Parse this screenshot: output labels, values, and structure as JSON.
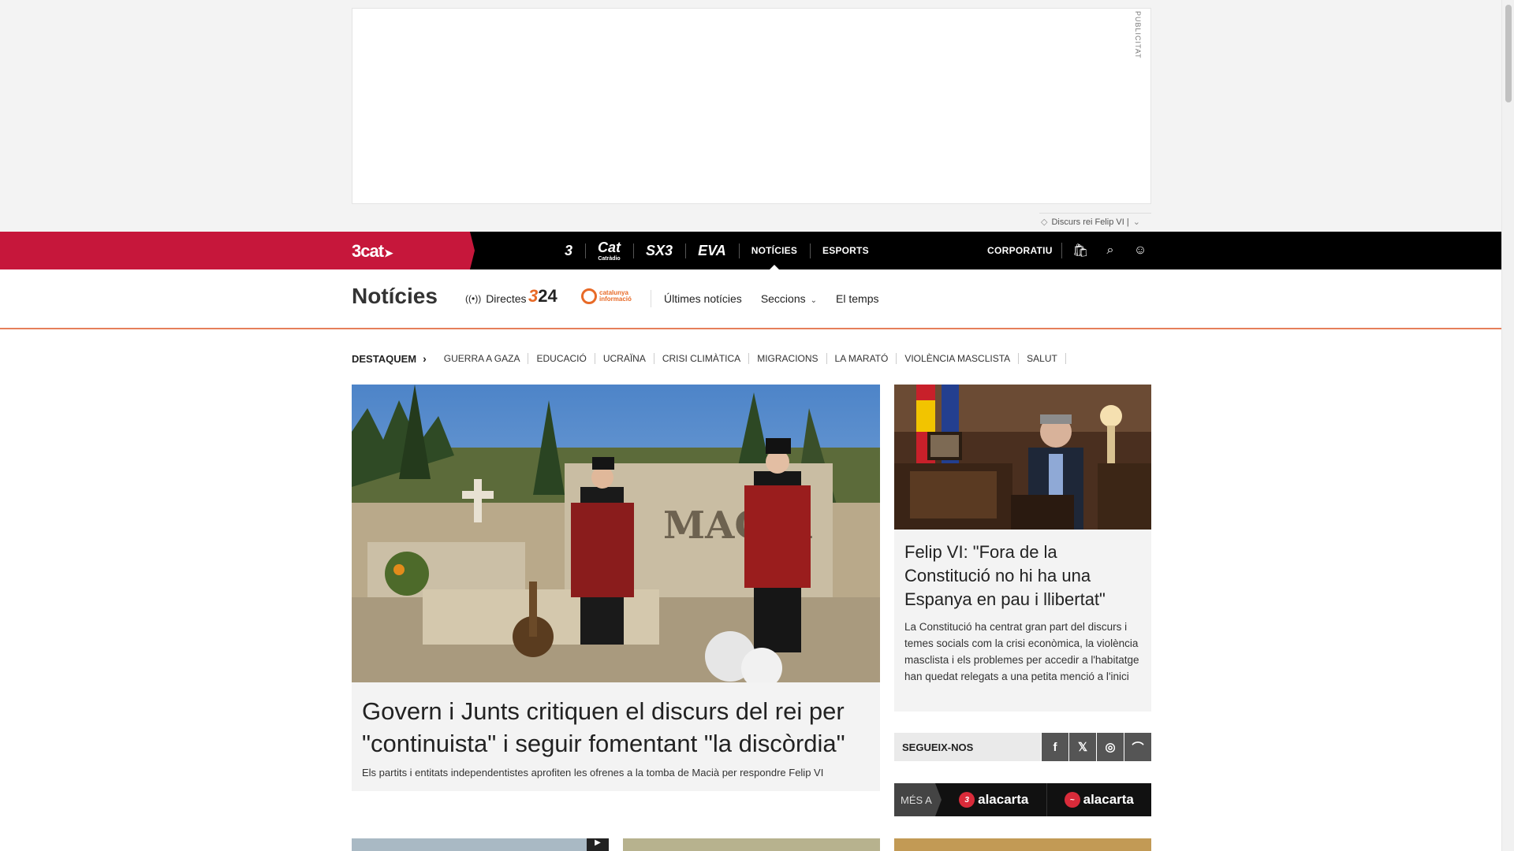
{
  "ad": {
    "label": "PUBLICITAT",
    "tag_text": "Discurs rei Felip VI |"
  },
  "topnav": {
    "brand": "3cat",
    "channels": [
      {
        "name": "3",
        "logo": "tv3-logo"
      },
      {
        "name": "Cat",
        "sub": "Catràdio",
        "logo": "catradio-logo"
      },
      {
        "name": "SX3",
        "logo": "sx3-logo"
      },
      {
        "name": "EVA",
        "logo": "eva-logo"
      }
    ],
    "sections": [
      "NOTÍCIES",
      "ESPORTS"
    ],
    "active_section": "NOTÍCIES",
    "corporate": "CORPORATIU",
    "icons": [
      "shopping-bag-icon",
      "search-icon",
      "user-icon"
    ]
  },
  "subheader": {
    "title": "Notícies",
    "directes": "Directes",
    "logo_324": {
      "three": "3",
      "rest": "24"
    },
    "logo_ci": {
      "line1": "catalunya",
      "line2": "informació"
    },
    "links": [
      "Últimes notícies",
      "Seccions",
      "El temps"
    ]
  },
  "tags": {
    "destaquem": "DESTAQUEM",
    "items": [
      "GUERRA A GAZA",
      "EDUCACIÓ",
      "UCRAÏNA",
      "CRISI CLIMÀTICA",
      "MIGRACIONS",
      "LA MARATÓ",
      "VIOLÈNCIA MASCLISTA",
      "SALUT"
    ]
  },
  "main_article": {
    "title": "Govern i Junts critiquen el discurs del rei per \"continuista\" i seguir fomentant \"la discòrdia\"",
    "subtitle": "Els partits i entitats independentistes aprofiten les ofrenes a la tomba de Macià per respondre Felip VI",
    "image_text": "MACIÀ"
  },
  "side_article": {
    "title": "Felip VI: \"Fora de la Constitució no hi ha una Espanya en pau i llibertat\"",
    "subtitle": "La Constitució ha centrat gran part del discurs i temes socials com la crisi econòmica, la violència masclista i els problemes per accedir a l'habitatge han quedat relegats a una petita menció a l'inici"
  },
  "follow": {
    "label": "SEGUEIX-NOS",
    "networks": [
      "facebook-icon",
      "x-icon",
      "instagram-icon",
      "rss-icon"
    ]
  },
  "alacarta": {
    "mes": "MÉS A",
    "items": [
      {
        "badge": "3",
        "label": "alacarta"
      },
      {
        "badge": "~",
        "label": "alacarta"
      }
    ]
  }
}
